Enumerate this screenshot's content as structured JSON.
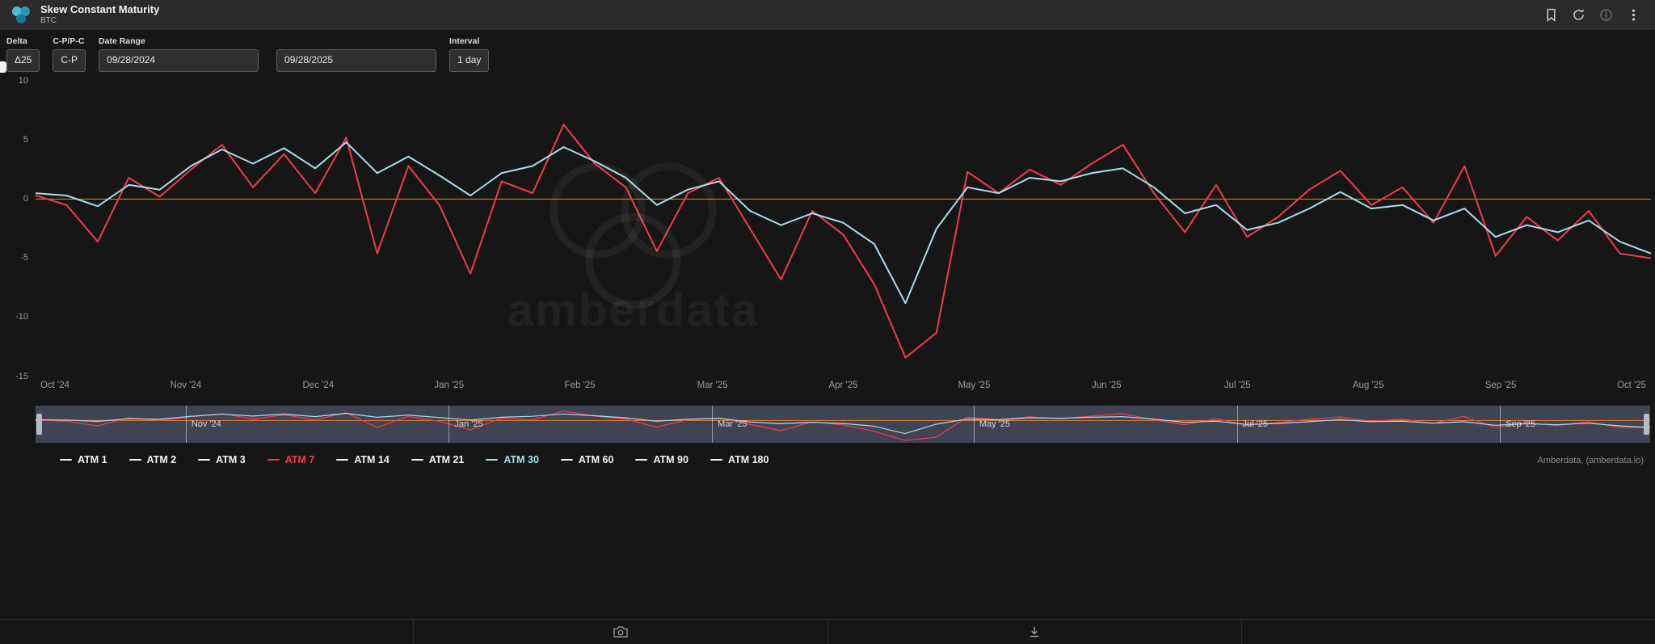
{
  "header": {
    "title": "Skew Constant Maturity",
    "subtitle": "BTC",
    "actions": [
      "bookmark-icon",
      "refresh-icon",
      "info-icon",
      "kebab-menu-icon"
    ]
  },
  "controls": {
    "delta": {
      "label": "Delta",
      "value": "Δ25"
    },
    "cp_pc": {
      "label": "C-P/P-C",
      "value": "C-P"
    },
    "date_range": {
      "label": "Date Range",
      "start": "09/28/2024",
      "end": "09/28/2025"
    },
    "interval": {
      "label": "Interval",
      "value": "1 day"
    }
  },
  "chart_data": {
    "type": "line",
    "title": "Skew Constant Maturity",
    "xlabel": "",
    "ylabel": "",
    "ylim": [
      -15,
      10
    ],
    "y_ticks": [
      10,
      5,
      0,
      -5,
      -10,
      -15
    ],
    "grid": false,
    "legend_position": "bottom",
    "zero_line": {
      "value": 0,
      "color": "#e8822a"
    },
    "x_unit": "weekly samples, 2024-09-28 to 2025-09-27",
    "x_labels": [
      {
        "label": "Oct '24",
        "frac": 0.012
      },
      {
        "label": "Nov '24",
        "frac": 0.093
      },
      {
        "label": "Dec '24",
        "frac": 0.175
      },
      {
        "label": "Jan '25",
        "frac": 0.256
      },
      {
        "label": "Feb '25",
        "frac": 0.337
      },
      {
        "label": "Mar '25",
        "frac": 0.419
      },
      {
        "label": "Apr '25",
        "frac": 0.5
      },
      {
        "label": "May '25",
        "frac": 0.581
      },
      {
        "label": "Jun '25",
        "frac": 0.663
      },
      {
        "label": "Jul '25",
        "frac": 0.744
      },
      {
        "label": "Aug '25",
        "frac": 0.825
      },
      {
        "label": "Sep '25",
        "frac": 0.907
      },
      {
        "label": "Oct '25",
        "frac": 0.988
      }
    ],
    "series": [
      {
        "name": "ATM 7",
        "color": "#f23a4c",
        "values": [
          0.3,
          -0.5,
          -3.6,
          1.8,
          0.2,
          2.5,
          4.6,
          1.0,
          3.8,
          0.5,
          5.2,
          -4.6,
          2.8,
          -0.5,
          -6.3,
          1.5,
          0.5,
          6.3,
          3.0,
          1.0,
          -4.4,
          0.5,
          1.8,
          -2.5,
          -6.8,
          -1.0,
          -3.0,
          -7.2,
          -13.4,
          -11.3,
          2.3,
          0.5,
          2.5,
          1.2,
          3.0,
          4.6,
          0.5,
          -2.8,
          1.2,
          -3.2,
          -1.5,
          0.8,
          2.4,
          -0.5,
          1.0,
          -2.0,
          2.8,
          -4.8,
          -1.5,
          -3.5,
          -1.0,
          -4.6,
          -5.0
        ]
      },
      {
        "name": "ATM 30",
        "color": "#a9dcec",
        "values": [
          0.5,
          0.3,
          -0.6,
          1.2,
          0.8,
          2.8,
          4.2,
          3.0,
          4.3,
          2.6,
          4.8,
          2.2,
          3.6,
          2.0,
          0.3,
          2.2,
          2.8,
          4.4,
          3.2,
          1.8,
          -0.5,
          0.8,
          1.5,
          -1.0,
          -2.2,
          -1.2,
          -2.0,
          -3.8,
          -8.8,
          -2.5,
          1.0,
          0.5,
          1.8,
          1.5,
          2.2,
          2.6,
          1.0,
          -1.2,
          -0.5,
          -2.6,
          -2.0,
          -0.8,
          0.6,
          -0.8,
          -0.5,
          -1.8,
          -0.8,
          -3.2,
          -2.2,
          -2.8,
          -1.8,
          -3.6,
          -4.6
        ]
      }
    ]
  },
  "navigator": {
    "labels": [
      {
        "label": "Nov '24",
        "frac": 0.093
      },
      {
        "label": "Jan '25",
        "frac": 0.256
      },
      {
        "label": "Mar '25",
        "frac": 0.419
      },
      {
        "label": "May '25",
        "frac": 0.581
      },
      {
        "label": "Jul '25",
        "frac": 0.744
      },
      {
        "label": "Sep '25",
        "frac": 0.907
      }
    ]
  },
  "legend": {
    "items": [
      {
        "label": "ATM 1",
        "color": "#f2f2f2"
      },
      {
        "label": "ATM 2",
        "color": "#f2f2f2"
      },
      {
        "label": "ATM 3",
        "color": "#f2f2f2"
      },
      {
        "label": "ATM 7",
        "color": "#f23a4c"
      },
      {
        "label": "ATM 14",
        "color": "#f2f2f2"
      },
      {
        "label": "ATM 21",
        "color": "#f2f2f2"
      },
      {
        "label": "ATM 30",
        "color": "#a9dcec"
      },
      {
        "label": "ATM 60",
        "color": "#f2f2f2"
      },
      {
        "label": "ATM 90",
        "color": "#f2f2f2"
      },
      {
        "label": "ATM 180",
        "color": "#f2f2f2"
      }
    ]
  },
  "watermark": {
    "text": "amberdata"
  },
  "attribution": "Amberdata, (amberdata.io)",
  "toolbar": {
    "cells": [
      "",
      "camera",
      "download",
      ""
    ]
  }
}
